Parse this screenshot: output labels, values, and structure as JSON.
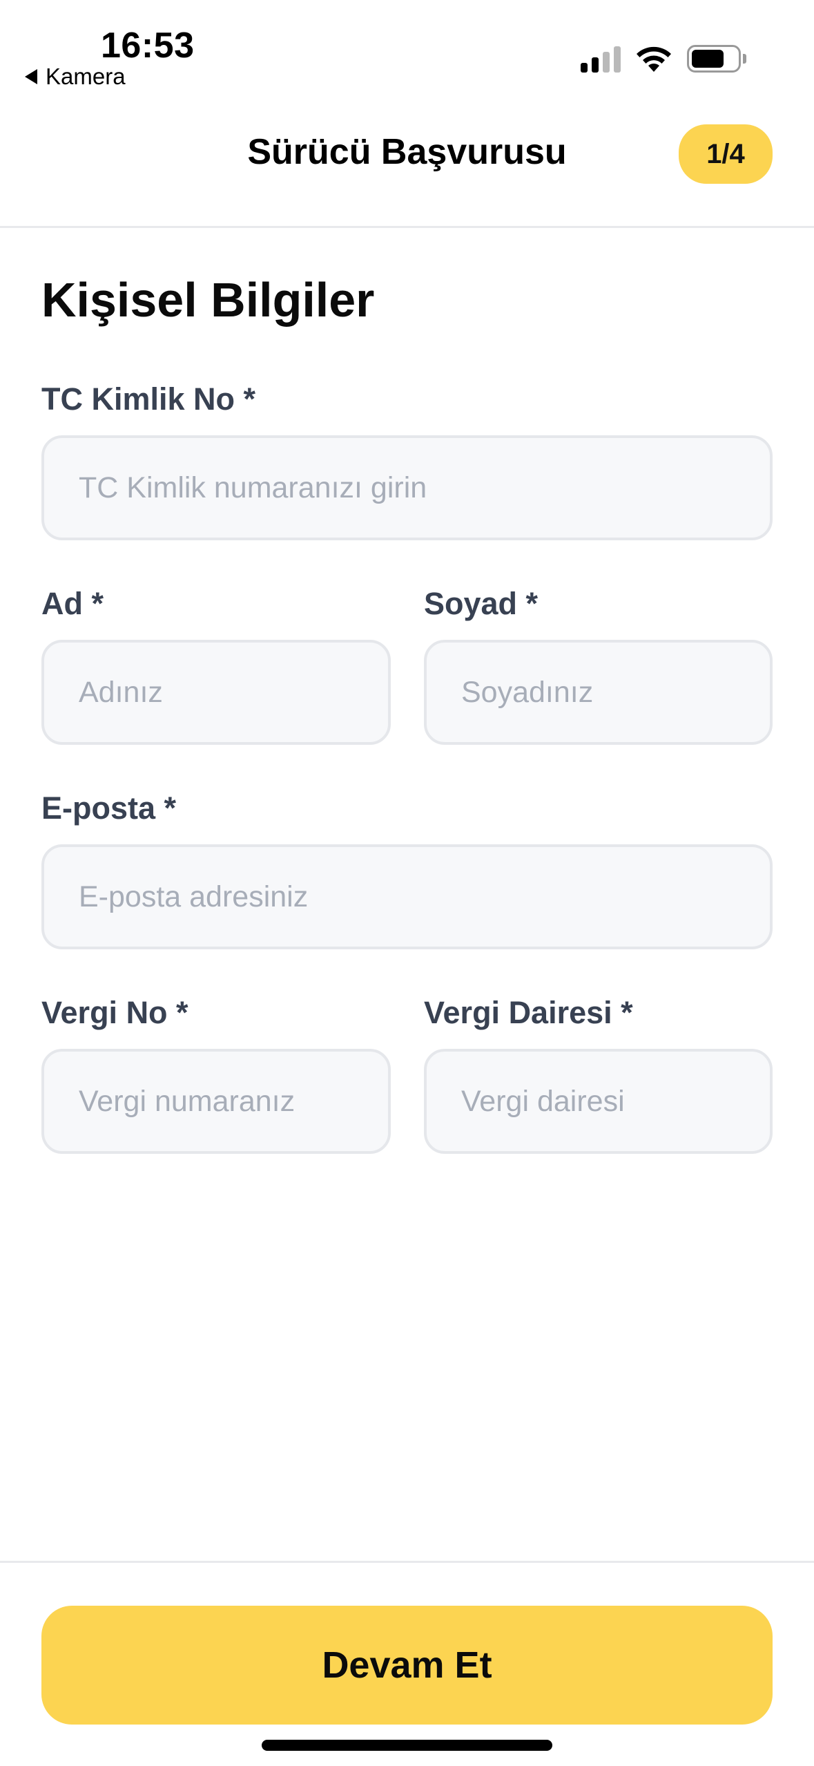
{
  "status_bar": {
    "time": "16:53",
    "back_app": "Kamera",
    "icons": [
      "back-triangle-icon",
      "cellular-signal-icon",
      "wifi-icon",
      "battery-icon"
    ]
  },
  "header": {
    "title": "Sürücü Başvurusu",
    "step": "1/4"
  },
  "form": {
    "section_title": "Kişisel Bilgiler",
    "tc": {
      "label": "TC Kimlik No *",
      "placeholder": "TC Kimlik numaranızı girin",
      "value": ""
    },
    "first_name": {
      "label": "Ad *",
      "placeholder": "Adınız",
      "value": ""
    },
    "last_name": {
      "label": "Soyad *",
      "placeholder": "Soyadınız",
      "value": ""
    },
    "email": {
      "label": "E-posta *",
      "placeholder": "E-posta adresiniz",
      "value": ""
    },
    "tax_no": {
      "label": "Vergi No *",
      "placeholder": "Vergi numaranız",
      "value": ""
    },
    "tax_office": {
      "label": "Vergi Dairesi *",
      "placeholder": "Vergi dairesi",
      "value": ""
    }
  },
  "footer": {
    "continue_label": "Devam Et"
  },
  "colors": {
    "accent": "#FCD451",
    "label": "#384152",
    "placeholder": "#A7ADB8",
    "input_bg": "#F7F8FA",
    "input_border": "#E5E7EB"
  }
}
